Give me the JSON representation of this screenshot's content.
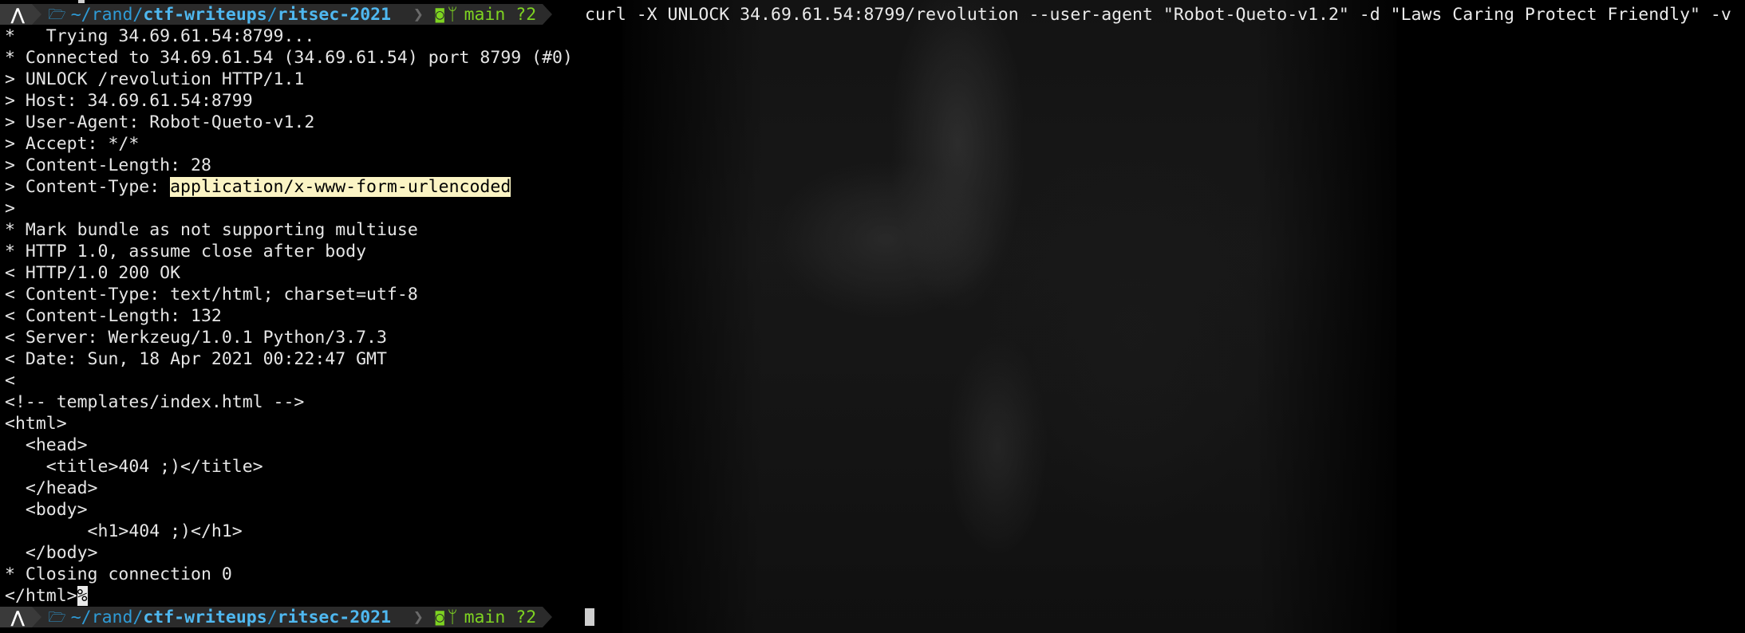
{
  "prompt": {
    "os_icon": "arch-linux-icon",
    "path_prefix": "~/rand/",
    "path_dir1": "ctf-writeups",
    "path_sep": "/",
    "path_dir2": "ritsec-2021",
    "git_branch": "main",
    "git_status": "?2"
  },
  "command": "curl -X UNLOCK 34.69.61.54:8799/revolution --user-agent \"Robot-Queto-v1.2\" -d \"Laws Caring Protect Friendly\" -v",
  "output": [
    "*   Trying 34.69.61.54:8799...",
    "* Connected to 34.69.61.54 (34.69.61.54) port 8799 (#0)",
    "> UNLOCK /revolution HTTP/1.1",
    "> Host: 34.69.61.54:8799",
    "> User-Agent: Robot-Queto-v1.2",
    "> Accept: */*",
    "> Content-Length: 28",
    ">",
    "* Mark bundle as not supporting multiuse",
    "* HTTP 1.0, assume close after body",
    "< HTTP/1.0 200 OK",
    "< Content-Type: text/html; charset=utf-8",
    "< Content-Length: 132",
    "< Server: Werkzeug/1.0.1 Python/3.7.3",
    "< Date: Sun, 18 Apr 2021 00:22:47 GMT",
    "<",
    "<!-- templates/index.html -->",
    "<html>",
    "  <head>",
    "    <title>404 ;)</title>",
    "  </head>",
    "  <body>",
    "        <h1>404 ;)</h1>",
    "  </body>",
    "* Closing connection 0"
  ],
  "content_type_line": {
    "prefix": "> Content-Type: ",
    "value": "application/x-www-form-urlencoded"
  },
  "last_line": {
    "text": "</html>",
    "no_newline_mark": "%"
  },
  "colors": {
    "path": "#2f9bd6",
    "git": "#7ed321",
    "highlight": "#fbf4c4",
    "background": "#000000"
  }
}
